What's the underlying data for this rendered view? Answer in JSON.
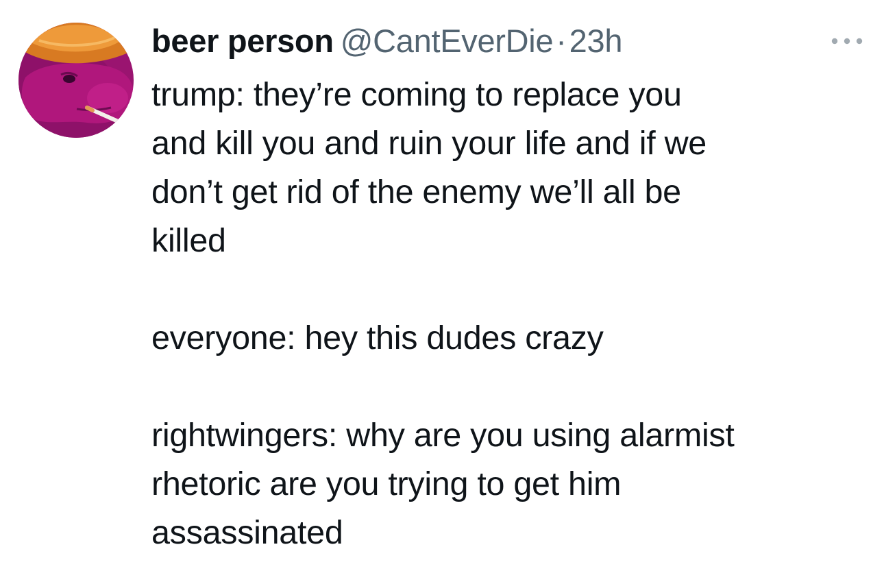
{
  "tweet": {
    "author": {
      "display_name": "beer person",
      "handle": "@CantEverDie",
      "avatar_icon": "avatar-purple-dinosaur-cowboy-hat"
    },
    "separator": "·",
    "timestamp": "23h",
    "more_icon": "more-options-icon",
    "body": {
      "lines_1": [
        "trump:  they’re coming to replace you",
        "and kill you and ruin your life and if we",
        "don’t get rid of the enemy we’ll all be",
        "killed"
      ],
      "line_2": "everyone:  hey this dudes crazy",
      "lines_3": [
        "rightwingers:  why are you using alarmist",
        "rhetoric are you trying to get him",
        "assassinated"
      ]
    }
  },
  "colors": {
    "text_primary": "#0f1419",
    "text_secondary": "#536471",
    "background": "#ffffff",
    "avatar_purple": "#a3146f",
    "avatar_hat": "#e88b2a"
  }
}
